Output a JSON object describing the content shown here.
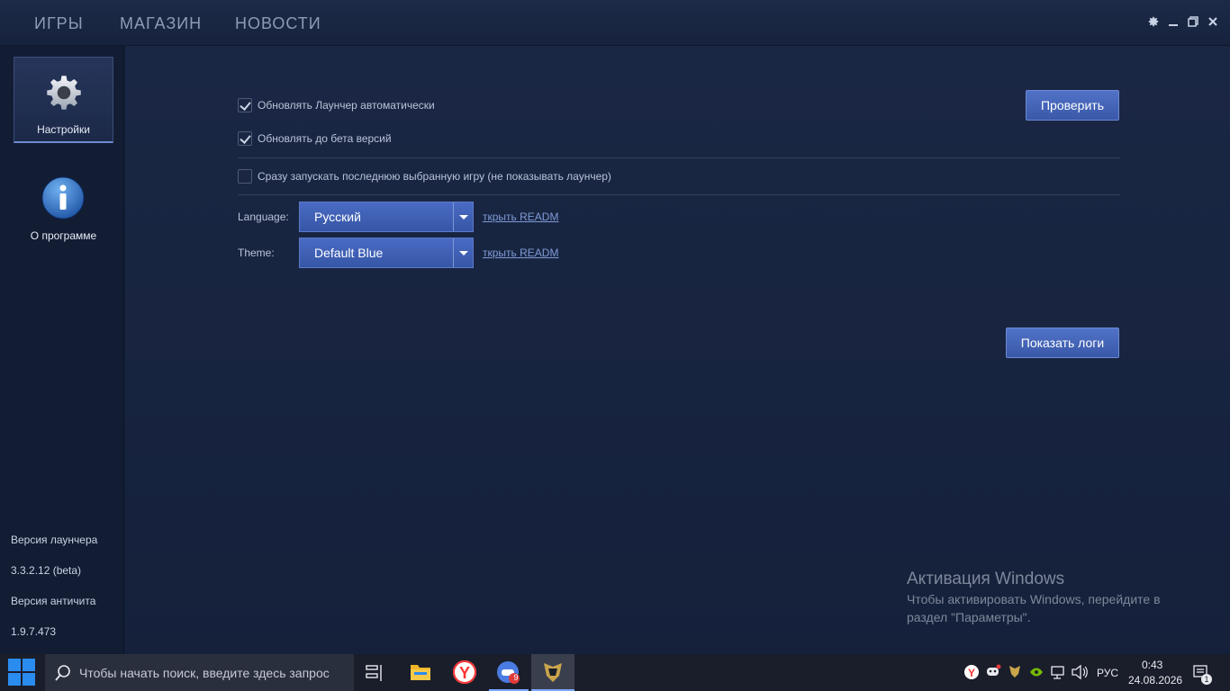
{
  "nav": {
    "tabs": [
      "ИГРЫ",
      "МАГАЗИН",
      "НОВОСТИ"
    ]
  },
  "sidebar": {
    "items": [
      {
        "label": "Настройки",
        "icon": "gear-icon",
        "active": true
      },
      {
        "label": "О программе",
        "icon": "info-icon",
        "active": false
      }
    ],
    "launcher_version_label": "Версия лаунчера",
    "launcher_version": "3.3.2.12 (beta)",
    "anticheat_version_label": "Версия античита",
    "anticheat_version": "1.9.7.473"
  },
  "settings": {
    "auto_update_label": "Обновлять Лаунчер автоматически",
    "auto_update_checked": true,
    "beta_update_label": "Обновлять до бета версий",
    "beta_update_checked": true,
    "launch_last_label": "Сразу запускать последнюю выбранную игру (не показывать лаунчер)",
    "launch_last_checked": false,
    "check_button": "Проверить",
    "language_label": "Language:",
    "language_value": "Русский",
    "theme_label": "Theme:",
    "theme_value": "Default Blue",
    "readme_link_1": "ткрыть READM",
    "readme_link_2": "ткрыть READM",
    "show_logs_button": "Показать логи"
  },
  "watermark": {
    "title": "Активация Windows",
    "text": "Чтобы активировать Windows, перейдите в раздел \"Параметры\"."
  },
  "taskbar": {
    "search_placeholder": "Чтобы начать поиск, введите здесь запрос",
    "apps": [
      "file-explorer-icon",
      "yandex-browser-icon",
      "game-app-icon",
      "launcher-app-icon"
    ],
    "app_badge": "9",
    "language": "РУС",
    "time": "0:43",
    "date": "24.08.2026",
    "notifications": "1"
  },
  "colors": {
    "accent": "#4a6bc4",
    "background": "#14203a"
  }
}
